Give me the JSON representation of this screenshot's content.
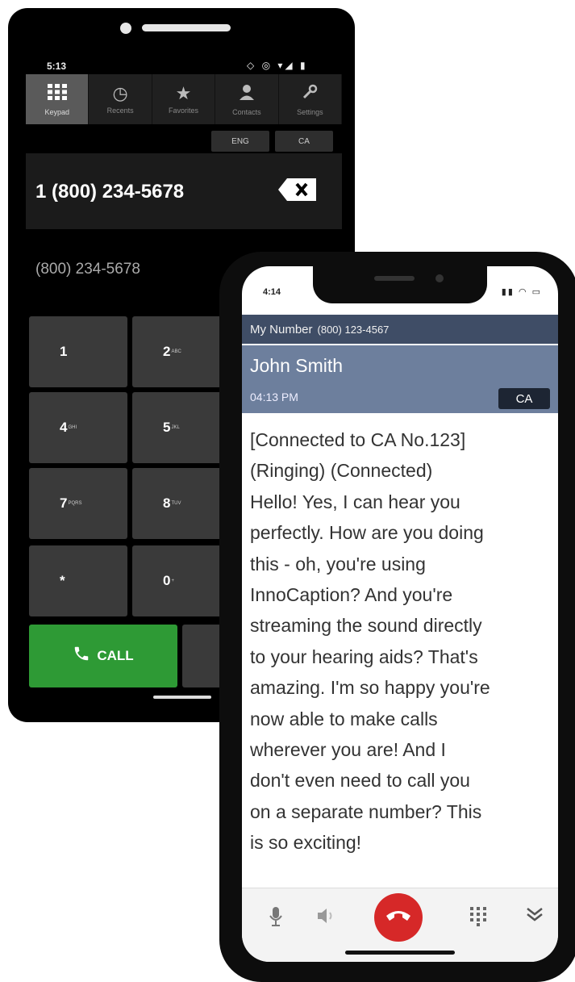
{
  "android": {
    "status_time": "5:13",
    "status_icons": "◇ ◎ ▾◢ ▮",
    "tabs": [
      {
        "label": "Keypad",
        "icon": "⋮⋮⋮"
      },
      {
        "label": "Recents",
        "icon": "◷"
      },
      {
        "label": "Favorites",
        "icon": "★"
      },
      {
        "label": "Contacts",
        "icon": "👤"
      },
      {
        "label": "Settings",
        "icon": "⚙"
      }
    ],
    "lang_buttons": [
      "ENG",
      "CA"
    ],
    "dialed_number": "1 (800) 234-5678",
    "suggested_number": "(800) 234-5678",
    "keys": [
      {
        "digit": "1",
        "letters": ""
      },
      {
        "digit": "2",
        "letters": "ABC"
      },
      {
        "digit": "4",
        "letters": "GHI"
      },
      {
        "digit": "5",
        "letters": "JKL"
      },
      {
        "digit": "7",
        "letters": "PQRS"
      },
      {
        "digit": "8",
        "letters": "TUV"
      },
      {
        "digit": "*",
        "letters": ""
      },
      {
        "digit": "0",
        "letters": "+"
      }
    ],
    "call_label": "CALL",
    "accent_green": "#2e9a35"
  },
  "iphone": {
    "status_time": "4:14",
    "status_icons": "▮▮ ◠ ▭",
    "my_number_label": "My Number",
    "my_number_value": "(800) 123-4567",
    "caller_name": "John Smith",
    "call_time": "04:13 PM",
    "ca_badge": "CA",
    "caption_text": "[Connected to CA No.123]\n(Ringing) (Connected)\nHello! Yes, I can hear you\nperfectly. How are you doing\nthis - oh, you're using\nInnoCaption? And you're\nstreaming the sound directly\nto your hearing aids? That's\namazing. I'm so happy you're\nnow able to make calls\nwherever you are! And I\ndon't even need to call you\non a separate number? This\nis so exciting!",
    "header_color": "#3f4d66",
    "caller_bar_color": "#6d7f9d",
    "end_call_color": "#d62828"
  }
}
